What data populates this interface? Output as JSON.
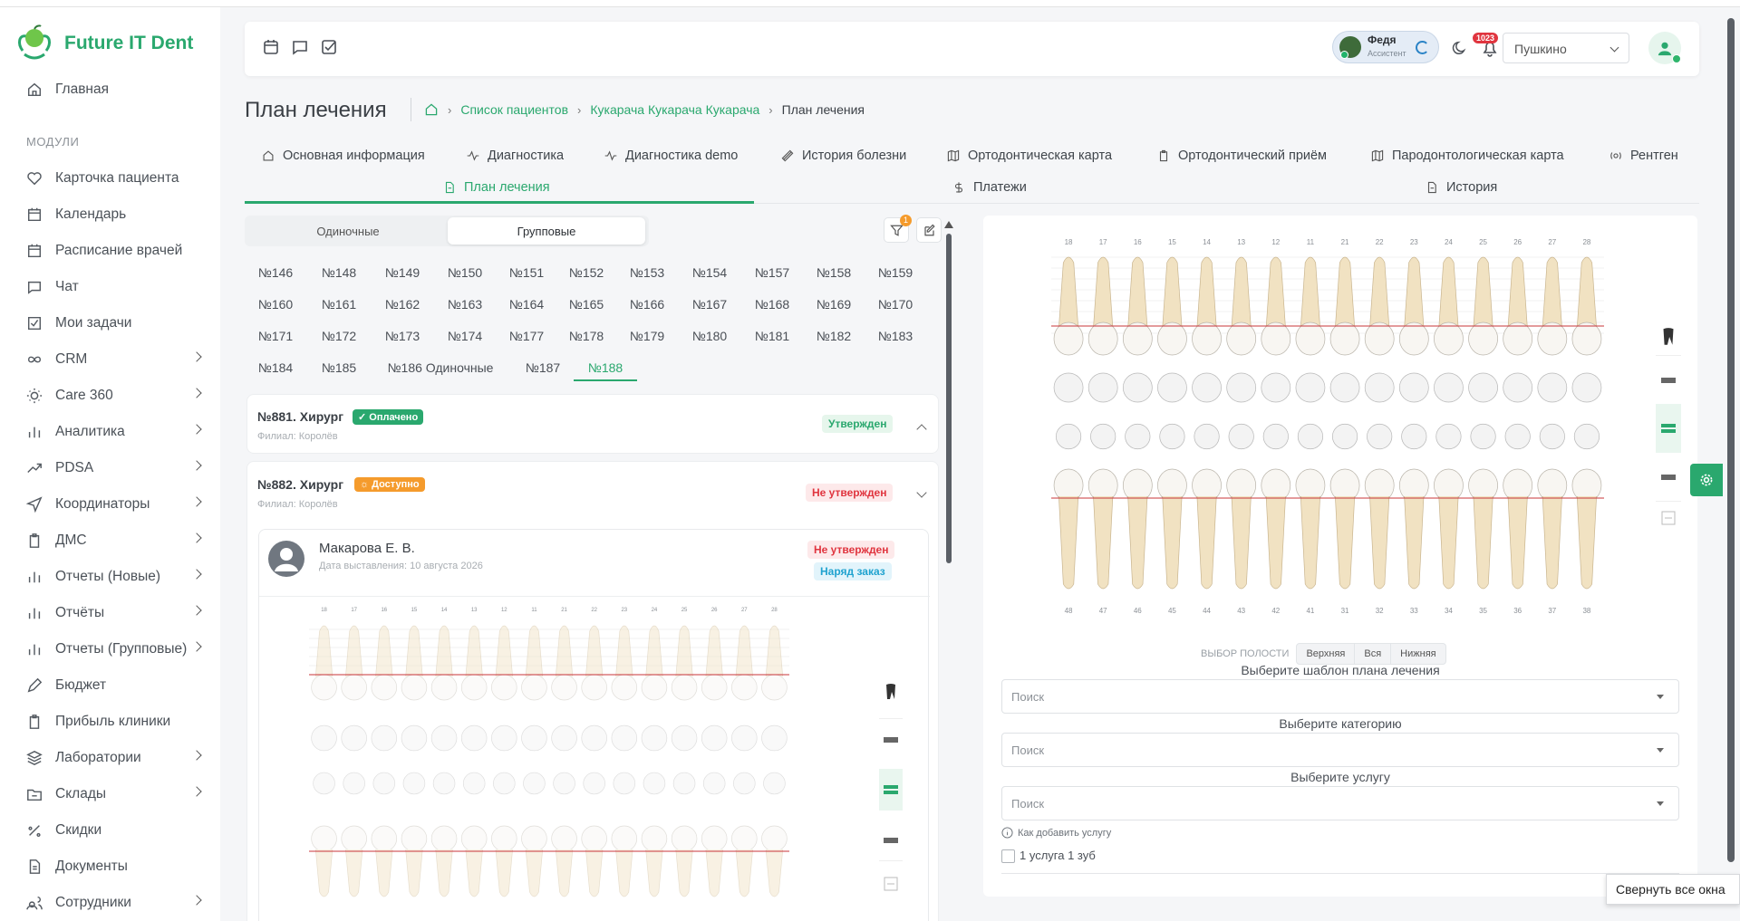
{
  "app": {
    "name": "Future IT Dent"
  },
  "sidebar": {
    "home": "Главная",
    "section": "МОДУЛИ",
    "items": [
      {
        "label": "Карточка пациента",
        "icon": "heart-icon",
        "chev": false
      },
      {
        "label": "Календарь",
        "icon": "calendar-icon",
        "chev": false
      },
      {
        "label": "Расписание врачей",
        "icon": "calendar-icon",
        "chev": false
      },
      {
        "label": "Чат",
        "icon": "chat-icon",
        "chev": false
      },
      {
        "label": "Мои задачи",
        "icon": "checkbox-icon",
        "chev": false
      },
      {
        "label": "CRM",
        "icon": "infinity-icon",
        "chev": true
      },
      {
        "label": "Care 360",
        "icon": "sun-icon",
        "chev": true
      },
      {
        "label": "Аналитика",
        "icon": "bar-chart-icon",
        "chev": true
      },
      {
        "label": "PDSA",
        "icon": "trend-icon",
        "chev": true
      },
      {
        "label": "Координаторы",
        "icon": "send-icon",
        "chev": true
      },
      {
        "label": "ДМС",
        "icon": "clipboard-icon",
        "chev": true
      },
      {
        "label": "Отчеты (Новые)",
        "icon": "bar-chart-icon",
        "chev": true
      },
      {
        "label": "Отчёты",
        "icon": "bar-chart-icon",
        "chev": true
      },
      {
        "label": "Отчеты (Групповые)",
        "icon": "bar-chart-icon",
        "chev": true
      },
      {
        "label": "Бюджет",
        "icon": "pen-icon",
        "chev": false
      },
      {
        "label": "Прибыль клиники",
        "icon": "clipboard-icon",
        "chev": false
      },
      {
        "label": "Лаборатории",
        "icon": "layers-icon",
        "chev": true
      },
      {
        "label": "Склады",
        "icon": "folder-icon",
        "chev": true
      },
      {
        "label": "Скидки",
        "icon": "percent-icon",
        "chev": false
      },
      {
        "label": "Документы",
        "icon": "document-icon",
        "chev": false
      },
      {
        "label": "Сотрудники",
        "icon": "users-icon",
        "chev": true
      }
    ]
  },
  "header": {
    "assistant_name": "Федя",
    "assistant_role": "Ассистент",
    "notifications": "1023",
    "branch": "Пушкино"
  },
  "page": {
    "title": "План лечения",
    "breadcrumb": [
      "Список пациентов",
      "Кукарача Кукарача Кукарача",
      "План лечения"
    ]
  },
  "tabs": {
    "row1": [
      "Основная информация",
      "Диагностика",
      "Диагностика demo",
      "История болезни",
      "Ортодонтическая карта",
      "Ортодонтический приём",
      "Пародонтологическая карта",
      "Рентген"
    ],
    "row2": [
      "План лечения",
      "Платежи",
      "История"
    ]
  },
  "left": {
    "segment": [
      "Одиночные",
      "Групповые"
    ],
    "filter_count": "1",
    "numbers": [
      [
        "№146",
        "№148",
        "№149",
        "№150",
        "№151",
        "№152",
        "№153",
        "№154",
        "№157",
        "№158",
        "№159"
      ],
      [
        "№160",
        "№161",
        "№162",
        "№163",
        "№164",
        "№165",
        "№166",
        "№167",
        "№168",
        "№169",
        "№170"
      ],
      [
        "№171",
        "№172",
        "№173",
        "№174",
        "№177",
        "№178",
        "№179",
        "№180",
        "№181",
        "№182",
        "№183"
      ],
      [
        "№184",
        "№185",
        "№186 Одиночные",
        "№187",
        "№188"
      ]
    ],
    "plans": [
      {
        "title": "№881. Хирург",
        "badge": "✓ Оплачено",
        "branch": "Филиал: Королёв",
        "status": "Утвержден"
      },
      {
        "title": "№882. Хирург",
        "badge": "☼ Доступно",
        "branch": "Филиал: Королёв",
        "status": "Не утвержден"
      }
    ],
    "doctor": {
      "name": "Макарова Е. В.",
      "date": "Дата выставления: 10 августа 2026",
      "status": "Не утвержден",
      "order": "Наряд заказ"
    },
    "mini_upper_teeth": [
      "18",
      "17",
      "16",
      "15",
      "14",
      "13",
      "12",
      "11",
      "21",
      "22",
      "23",
      "24",
      "25",
      "26",
      "27",
      "28"
    ]
  },
  "right": {
    "upper_teeth": [
      "18",
      "17",
      "16",
      "15",
      "14",
      "13",
      "12",
      "11",
      "21",
      "22",
      "23",
      "24",
      "25",
      "26",
      "27",
      "28"
    ],
    "lower_teeth": [
      "48",
      "47",
      "46",
      "45",
      "44",
      "43",
      "42",
      "41",
      "31",
      "32",
      "33",
      "34",
      "35",
      "36",
      "37",
      "38"
    ],
    "jaw_label": "ВЫБОР ПОЛОСТИ",
    "jaw_options": [
      "Верхняя",
      "Вся",
      "Нижняя"
    ],
    "template_label": "Выберите шаблон плана лечения",
    "category_label": "Выберите категорию",
    "service_label": "Выберите услугу",
    "search_placeholder": "Поиск",
    "how_to": "Как добавить услугу",
    "checkbox_label": "1 услуга 1 зуб"
  },
  "tooltip": "Свернуть все окна",
  "colors": {
    "accent": "#2aa86e",
    "danger": "#e0353f",
    "warning": "#f59b2c",
    "info": "#1fa2cf"
  }
}
